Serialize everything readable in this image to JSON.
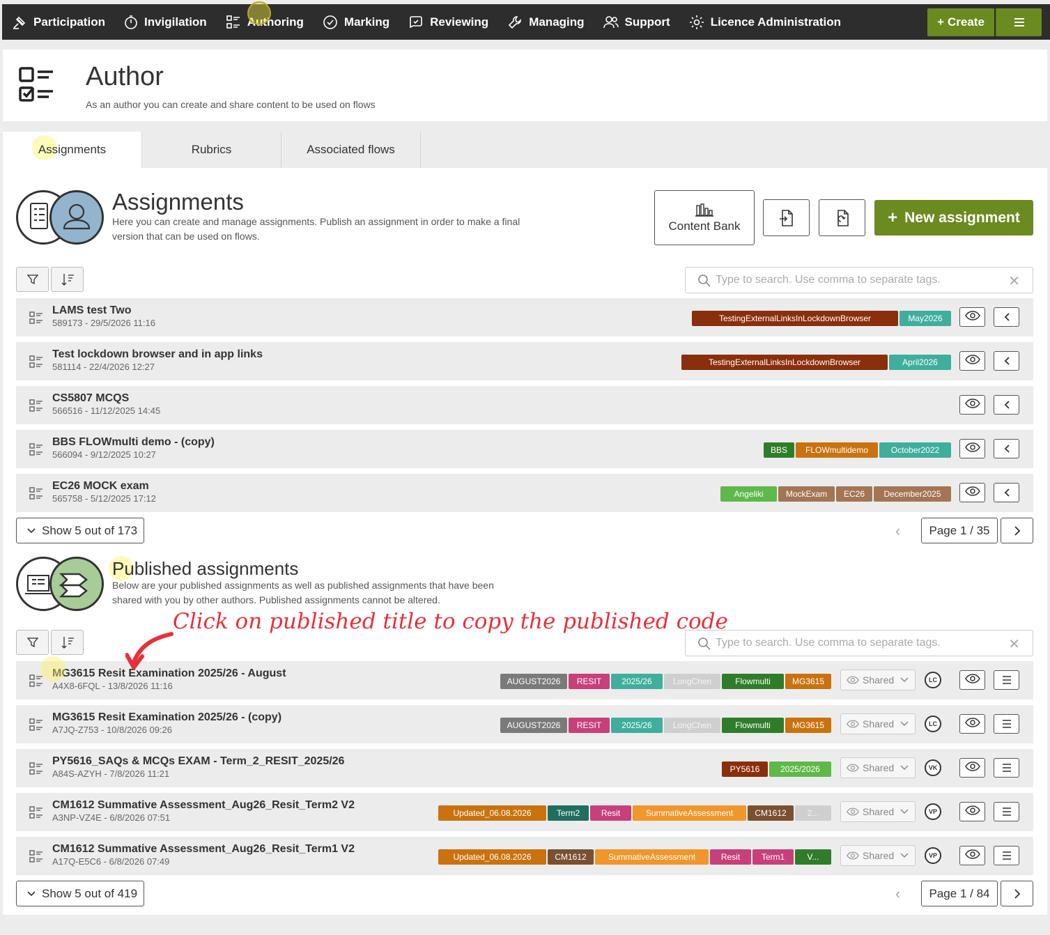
{
  "nav": {
    "items": [
      {
        "label": "Participation",
        "icon": "participation-icon"
      },
      {
        "label": "Invigilation",
        "icon": "stopwatch-icon"
      },
      {
        "label": "Authoring",
        "icon": "checklist-icon"
      },
      {
        "label": "Marking",
        "icon": "check-circle-icon"
      },
      {
        "label": "Reviewing",
        "icon": "review-icon"
      },
      {
        "label": "Managing",
        "icon": "wrench-icon"
      },
      {
        "label": "Support",
        "icon": "users-icon"
      },
      {
        "label": "Licence Administration",
        "icon": "gear-icon"
      }
    ],
    "create_label": "Create"
  },
  "header": {
    "title": "Author",
    "subtitle": "As an author you can create and share content to be used on flows"
  },
  "tabs": [
    "Assignments",
    "Rubrics",
    "Associated flows"
  ],
  "assignments": {
    "title": "Assignments",
    "desc_line1": "Here you can create and manage assignments. Publish an assignment in order to make a final",
    "desc_line2": "version that can be used on flows.",
    "content_bank_label": "Content Bank",
    "new_label": "New assignment",
    "search_placeholder": "Type to search. Use comma to separate tags.",
    "rows": [
      {
        "title": "LAMS test Two",
        "sub": "589173 - 29/5/2026 11:16",
        "tags": [
          {
            "t": "TestingExternalLinksInLockdownBrowser",
            "c": "#8b2e0c"
          },
          {
            "t": "May2026",
            "c": "#3fae9c"
          }
        ]
      },
      {
        "title": "Test lockdown browser and in app links",
        "sub": "581114 - 22/4/2026 12:27",
        "tags": [
          {
            "t": "TestingExternalLinksInLockdownBrowser",
            "c": "#8b2e0c"
          },
          {
            "t": "April2026",
            "c": "#3fae9c"
          }
        ]
      },
      {
        "title": "CS5807 MCQS",
        "sub": "566516 - 11/12/2025 14:45",
        "tags": []
      },
      {
        "title": "BBS FLOWmulti demo - (copy)",
        "sub": "566094 - 9/12/2025 10:27",
        "tags": [
          {
            "t": "BBS",
            "c": "#2f7d2a"
          },
          {
            "t": "FLOWmultidemo",
            "c": "#c9720e"
          },
          {
            "t": "October2022",
            "c": "#3fae9c"
          }
        ]
      },
      {
        "title": "EC26 MOCK exam",
        "sub": "565758 - 5/12/2025 17:12",
        "tags": [
          {
            "t": "Angeliki",
            "c": "#5fb84a"
          },
          {
            "t": "MockExam",
            "c": "#a37555"
          },
          {
            "t": "EC26",
            "c": "#a37555"
          },
          {
            "t": "December2025",
            "c": "#a37555"
          }
        ]
      }
    ],
    "show_label": "Show 5 out of 173",
    "page_label": "Page 1 / 35"
  },
  "published": {
    "title": "Published assignments",
    "desc_line1": "Below are your published assignments as well as published assignments that have been",
    "desc_line2": "shared with you by other authors. Published assignments cannot be altered.",
    "annotation": "Click on published title to copy the published code",
    "search_placeholder": "Type to search. Use comma to separate tags.",
    "shared_label": "Shared",
    "rows": [
      {
        "title": "MG3615 Resit Examination 2025/26 - August",
        "sub": "A4X8-6FQL - 13/8/2026 11:16",
        "avatar": "LC",
        "tags": [
          {
            "t": "AUGUST2026",
            "c": "#7a7a7a"
          },
          {
            "t": "RESIT",
            "c": "#c7407a"
          },
          {
            "t": "2025/26",
            "c": "#3fae9c"
          },
          {
            "t": "LongChen",
            "c": "#cfcfcf"
          },
          {
            "t": "Flowmulti",
            "c": "#2f7d2a"
          },
          {
            "t": "MG3615",
            "c": "#c9720e"
          }
        ]
      },
      {
        "title": "MG3615 Resit Examination 2025/26 - (copy)",
        "sub": "A7JQ-Z753 - 10/8/2026 09:26",
        "avatar": "LC",
        "tags": [
          {
            "t": "AUGUST2026",
            "c": "#7a7a7a"
          },
          {
            "t": "RESIT",
            "c": "#c7407a"
          },
          {
            "t": "2025/26",
            "c": "#3fae9c"
          },
          {
            "t": "LongChen",
            "c": "#cfcfcf"
          },
          {
            "t": "Flowmulti",
            "c": "#2f7d2a"
          },
          {
            "t": "MG3615",
            "c": "#c9720e"
          }
        ]
      },
      {
        "title": "PY5616_SAQs & MCQs EXAM - Term_2_RESIT_2025/26",
        "sub": "A84S-AZYH - 7/8/2026 11:21",
        "avatar": "VK",
        "tags": [
          {
            "t": "PY5616",
            "c": "#8b2e0c"
          },
          {
            "t": "2025/2026",
            "c": "#5fb84a"
          }
        ]
      },
      {
        "title": "CM1612 Summative Assessment_Aug26_Resit_Term2 V2",
        "sub": "A3NP-VZ4E - 6/8/2026 07:51",
        "avatar": "VP",
        "tags": [
          {
            "t": "Updated_06.08.2026",
            "c": "#c9720e"
          },
          {
            "t": "Term2",
            "c": "#1f6e5e"
          },
          {
            "t": "Resit",
            "c": "#c7407a"
          },
          {
            "t": "SummativeAssessment",
            "c": "#f0962a"
          },
          {
            "t": "CM1612",
            "c": "#7a5030"
          },
          {
            "t": "2...",
            "c": "#cfcfcf"
          }
        ]
      },
      {
        "title": "CM1612 Summative Assessment_Aug26_Resit_Term1 V2",
        "sub": "A17Q-E5C6 - 6/8/2026 07:49",
        "avatar": "VP",
        "tags": [
          {
            "t": "Updated_06.08.2026",
            "c": "#c9720e"
          },
          {
            "t": "CM1612",
            "c": "#7a5030"
          },
          {
            "t": "SummativeAssessment",
            "c": "#f0962a"
          },
          {
            "t": "Resit",
            "c": "#c7407a"
          },
          {
            "t": "Term1",
            "c": "#c7407a"
          },
          {
            "t": "V...",
            "c": "#2f7d2a"
          }
        ]
      }
    ],
    "show_label": "Show 5 out of 419",
    "page_label": "Page 1 / 84"
  },
  "colors": {
    "brand_green": "#6b8a1f",
    "nav_bg": "#2d2d2d",
    "annotation": "#e8303a"
  }
}
